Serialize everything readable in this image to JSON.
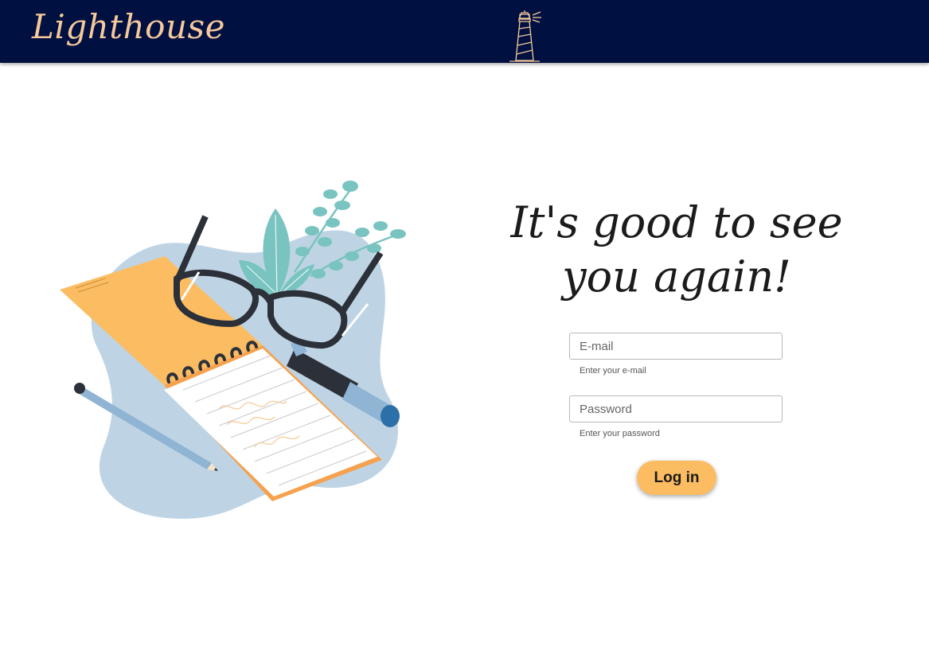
{
  "header": {
    "brand": "Lighthouse",
    "logo_icon": "lighthouse-icon",
    "background_color": "#001041",
    "brand_color": "#f6c99a"
  },
  "main": {
    "illustration_icon": "notebook-glasses-illustration",
    "headline": "It's good to see you again!",
    "email": {
      "placeholder": "E-mail",
      "value": "",
      "helper": "Enter your e-mail"
    },
    "password": {
      "placeholder": "Password",
      "value": "",
      "helper": "Enter your password"
    },
    "login_label": "Log in",
    "accent_color": "#fcbc62"
  }
}
